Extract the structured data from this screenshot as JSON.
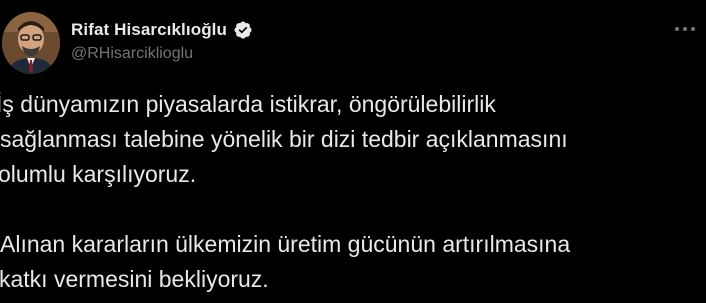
{
  "author": {
    "display_name": "Rifat Hisarcıklıoğlu",
    "handle": "@RHisarciklioglu",
    "verified": true
  },
  "icons": {
    "verified": "verified-badge-icon",
    "more": "more-options-icon"
  },
  "tweet": {
    "lines": [
      "İş dünyamızın piyasalarda istikrar, öngörülebilirlik",
      "sağlanması talebine yönelik bir dizi tedbir açıklanmasını",
      "olumlu karşılıyoruz.",
      "Alınan kararların ülkemizin üretim gücünün artırılmasına",
      "katkı vermesini bekliyoruz."
    ]
  },
  "colors": {
    "background": "#000000",
    "primary_text": "#e7e9ea",
    "secondary_text": "#71767b"
  }
}
